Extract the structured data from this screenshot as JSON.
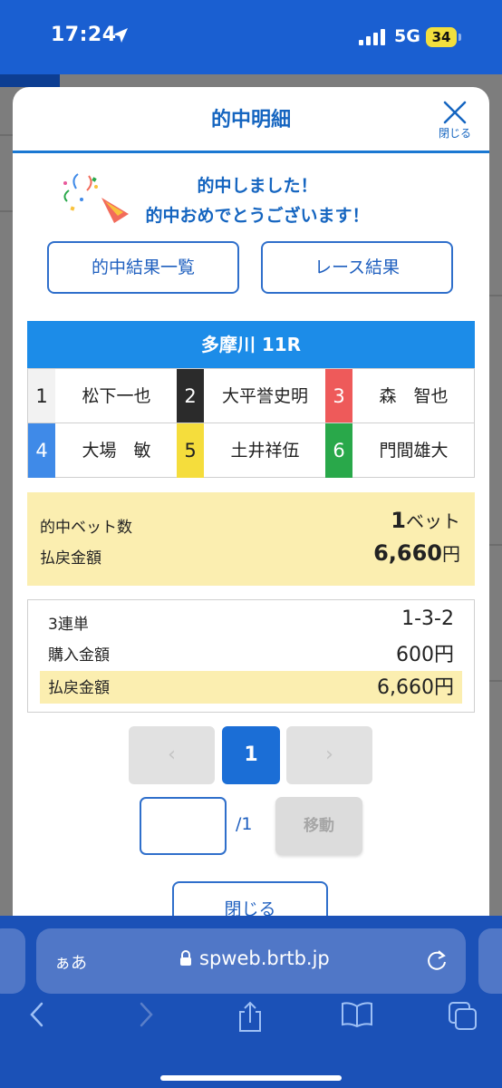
{
  "status_bar": {
    "time": "17:24",
    "network": "5G",
    "battery": "34"
  },
  "modal": {
    "title": "的中明細",
    "close_label": "閉じる",
    "message_line1": "的中しました！",
    "message_line2": "的中おめでとうございます！",
    "buttons": {
      "list": "的中結果一覧",
      "race_result": "レース結果"
    }
  },
  "race": {
    "header": "多摩川 11R",
    "racers": [
      {
        "num": "1",
        "name": "松下一也",
        "bg": "#f2f2f2",
        "fg": "#222222"
      },
      {
        "num": "2",
        "name": "大平誉史明",
        "bg": "#2b2b2b",
        "fg": "#ffffff"
      },
      {
        "num": "3",
        "name": "森　智也",
        "bg": "#ee5a5a",
        "fg": "#ffffff"
      },
      {
        "num": "4",
        "name": "大場　敏",
        "bg": "#3f8ae8",
        "fg": "#ffffff"
      },
      {
        "num": "5",
        "name": "土井祥伍",
        "bg": "#f5dd3c",
        "fg": "#222222"
      },
      {
        "num": "6",
        "name": "門間雄大",
        "bg": "#29a84a",
        "fg": "#ffffff"
      }
    ]
  },
  "summary": {
    "hit_bets_label": "的中ベット数",
    "hit_bets_value": "1",
    "hit_bets_unit": "ベット",
    "payout_label": "払戻金額",
    "payout_value": "6,660",
    "payout_unit": "円"
  },
  "detail": {
    "bet_type": "3連単",
    "combination": "1-3-2",
    "purchase_label": "購入金額",
    "purchase_value": "600円",
    "payout_label": "払戻金額",
    "payout_value": "6,660円"
  },
  "pagination": {
    "prev": "‹",
    "current": "1",
    "next": "›",
    "page_input": "",
    "total": "/1",
    "move_label": "移動"
  },
  "bottom_close": "閉じる",
  "browser": {
    "aa": "ぁあ",
    "url": "spweb.brtb.jp"
  },
  "colors": {
    "accent": "#1565c0",
    "header_blue": "#1c8ce8",
    "highlight": "#fbeeb0",
    "chrome": "#1b51b7"
  }
}
